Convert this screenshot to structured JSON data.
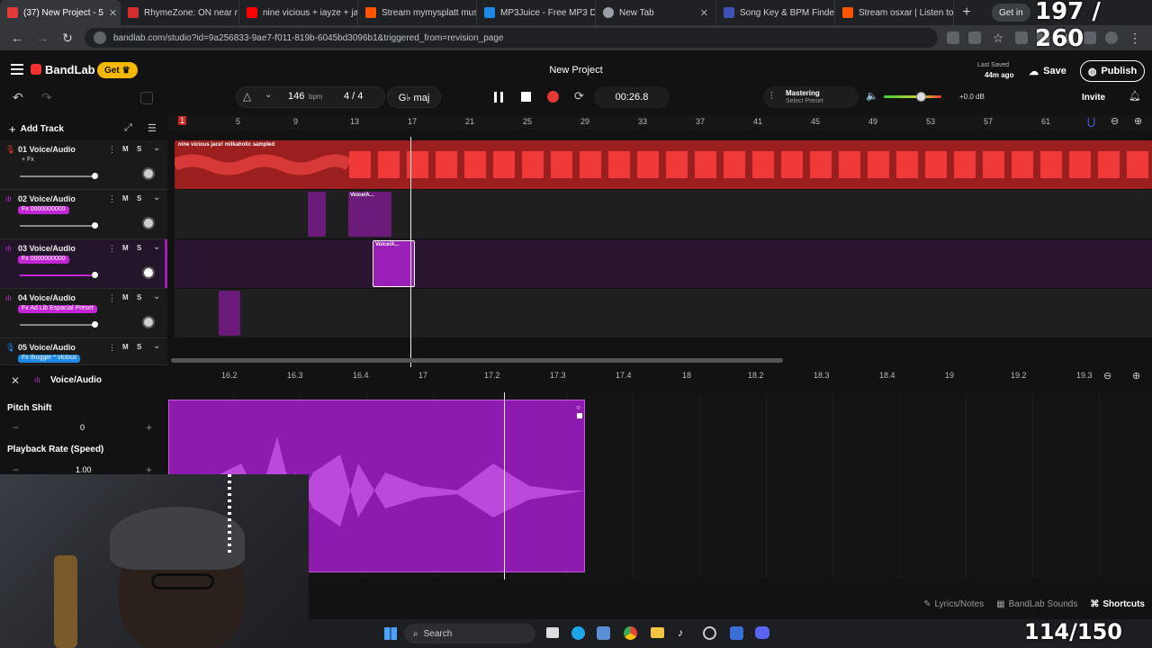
{
  "browser": {
    "tabs": [
      {
        "title": "(37) New Project - 5",
        "icon": "bandlab-icon",
        "color": "#e53935",
        "active": true
      },
      {
        "title": "RhymeZone: ON near r",
        "icon": "rhymezone-icon",
        "color": "#d32f2f"
      },
      {
        "title": "nine vicious + iayze + ja",
        "icon": "youtube-icon",
        "color": "#ff0000"
      },
      {
        "title": "Stream mymysplatt mus",
        "icon": "soundcloud-icon",
        "color": "#ff5500"
      },
      {
        "title": "MP3Juice - Free MP3 Do",
        "icon": "mp3juice-icon",
        "color": "#1e88e5"
      },
      {
        "title": "New Tab",
        "icon": "chrome-icon",
        "color": "#9aa0a6"
      },
      {
        "title": "Song Key & BPM Finde",
        "icon": "music-icon",
        "color": "#3f51b5"
      },
      {
        "title": "Stream osxar | Listen to",
        "icon": "soundcloud-icon",
        "color": "#ff5500"
      }
    ],
    "new_tab_label": "+",
    "getinfo_label": "Get in",
    "url": "bandlab.com/studio?id=9a256833-9ae7-f011-819b-6045bd3096b1&triggered_from=revision_page"
  },
  "overlay": {
    "counter_top": "197 / 260",
    "counter_bottom": "114/150"
  },
  "app": {
    "brand": "BandLab",
    "get_label": "Get",
    "project_title": "New Project",
    "last_saved_label": "Last Saved",
    "last_saved_time": "44m ago",
    "save_label": "Save",
    "publish_label": "Publish"
  },
  "toolbar": {
    "bpm_value": "146",
    "bpm_unit": "bpm",
    "time_sig": "4 / 4",
    "key": "G♭ maj",
    "time": "00:26.8",
    "mastering_label": "Mastering",
    "mastering_preset": "Select Preset",
    "master_volume_db": "+0.0 dB",
    "invite_label": "Invite",
    "add_track_label": "Add Track"
  },
  "ruler": {
    "bars": [
      "1",
      "5",
      "9",
      "13",
      "17",
      "21",
      "25",
      "29",
      "33",
      "37",
      "41",
      "45",
      "49",
      "53",
      "57",
      "61"
    ]
  },
  "tracks": [
    {
      "num": "01",
      "name": "Voice/Audio",
      "fx": "+ Fx",
      "fx_color": "#1a1a1a",
      "color": "#e53935",
      "volume": 1.0,
      "mute": "M",
      "solo": "S"
    },
    {
      "num": "02",
      "name": "Voice/Audio",
      "fx": "Fx 0000000000",
      "fx_color": "#c026d3",
      "color": "#a21caf",
      "volume": 1.0,
      "mute": "M",
      "solo": "S"
    },
    {
      "num": "03",
      "name": "Voice/Audio",
      "fx": "Fx 0000000000",
      "fx_color": "#c026d3",
      "color": "#a21caf",
      "volume": 1.0,
      "mute": "M",
      "solo": "S"
    },
    {
      "num": "04",
      "name": "Voice/Audio",
      "fx": "Fx Ad Lib Espacial Preset",
      "fx_color": "#c026d3",
      "color": "#a21caf",
      "volume": 1.0,
      "mute": "M",
      "solo": "S"
    },
    {
      "num": "05",
      "name": "Voice/Audio",
      "fx": "Fx thugger * vicious",
      "fx_color": "#1e88e5",
      "color": "#1e88e5",
      "volume": 1.0,
      "mute": "M",
      "solo": "S"
    }
  ],
  "clips": {
    "track1_label": "nine vicious  jace!  milkaholic  sampled",
    "track2_label": "Voice/A...",
    "track3_label": "Voice/A..."
  },
  "editor": {
    "title": "Voice/Audio",
    "pitch_label": "Pitch Shift",
    "pitch_value": "0",
    "rate_label": "Playback Rate (Speed)",
    "rate_value": "1.00",
    "ruler": [
      "16.2",
      "16.3",
      "16.4",
      "17",
      "17.2",
      "17.3",
      "17.4",
      "18",
      "18.2",
      "18.3",
      "18.4",
      "19",
      "19.2",
      "19.3"
    ]
  },
  "bottom": {
    "lyrics_label": "Lyrics/Notes",
    "sounds_label": "BandLab Sounds",
    "shortcuts_label": "Shortcuts"
  },
  "taskbar": {
    "search_label": "Search"
  }
}
